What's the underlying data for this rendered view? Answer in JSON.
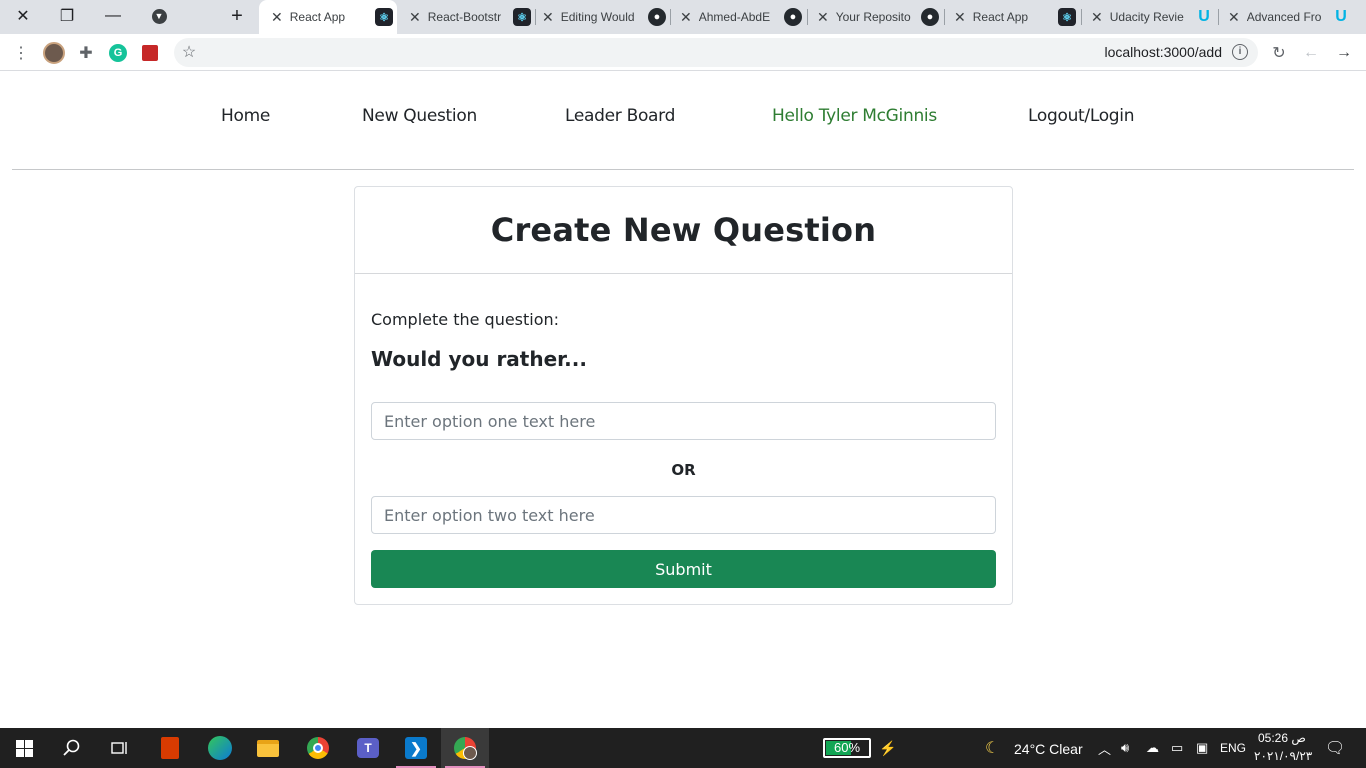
{
  "browser": {
    "tabs": [
      {
        "title": "React App",
        "active": true
      },
      {
        "title": "React-Bootstr",
        "active": false
      },
      {
        "title": "Editing Would",
        "active": false
      },
      {
        "title": "Ahmed-AbdE",
        "active": false
      },
      {
        "title": "Your Reposito",
        "active": false
      },
      {
        "title": "React App",
        "active": false
      },
      {
        "title": "Udacity Revie",
        "active": false
      },
      {
        "title": "Advanced Fro",
        "active": false
      }
    ],
    "new_tab_label": "+",
    "url": "localhost:3000/add"
  },
  "nav": {
    "home": "Home",
    "new_question": "New Question",
    "leader_board": "Leader Board",
    "greeting": "Hello Tyler McGinnis",
    "logout": "Logout/Login"
  },
  "card": {
    "title": "Create New Question",
    "prompt": "Complete the question:",
    "would_you_rather": "Would you rather...",
    "option_one_placeholder": "Enter option one text here",
    "or_label": "OR",
    "option_two_placeholder": "Enter option two text here",
    "submit_label": "Submit"
  },
  "taskbar": {
    "battery_percent": 60,
    "battery_label": "60%",
    "weather": "24°C  Clear",
    "language": "ENG",
    "time": "05:26 ص",
    "date": "٢٠٢١/٠٩/٢٣"
  },
  "colors": {
    "submit_bg": "#198754",
    "greeting_text": "#2e7d32",
    "battery_fill": "#12a554"
  }
}
